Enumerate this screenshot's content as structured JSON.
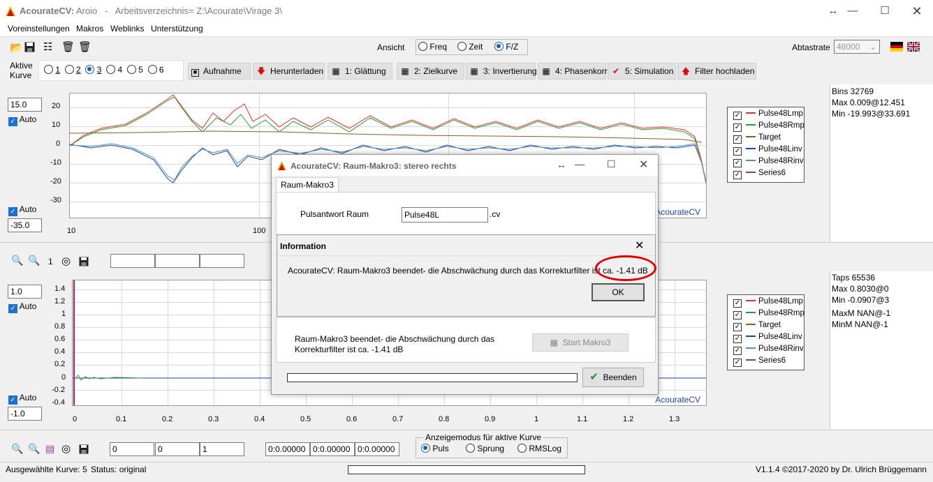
{
  "window": {
    "app_name": "AcourateCV:",
    "title_rest": "Aroio   -   Arbeitsverzeichnis= Z:\\Acourate\\Virage 3\\"
  },
  "menu": [
    "Voreinstellungen",
    "Makros",
    "Weblinks",
    "Unterstützung"
  ],
  "view": {
    "label": "Ansicht",
    "options": [
      "Freq",
      "Zeit",
      "F/Z"
    ],
    "selected": "F/Z"
  },
  "sample_rate": {
    "label": "Abtastrate",
    "value": "48000"
  },
  "active_curve": {
    "label_line1": "Aktive",
    "label_line2": "Kurve",
    "options": [
      "1",
      "2",
      "3",
      "4",
      "5",
      "6"
    ],
    "selected": "3"
  },
  "steps": [
    {
      "label": "Aufnahme",
      "icon": "record-icon"
    },
    {
      "label": "Herunterladen",
      "icon": "download-arrow-icon"
    },
    {
      "label": "1: Glättung",
      "icon": "calculator-icon"
    },
    {
      "label": "2: Zielkurve",
      "icon": "calculator-icon"
    },
    {
      "label": "3: Invertierung",
      "icon": "calculator-icon"
    },
    {
      "label": "4: Phasenkorr",
      "icon": "calculator-icon"
    },
    {
      "label": "5: Simulation",
      "icon": "checkmark-icon"
    },
    {
      "label": "Filter hochladen",
      "icon": "upload-arrow-icon"
    }
  ],
  "freq_plot": {
    "ymax_field": "15.0",
    "ymin_field": "-35.0",
    "auto_label": "Auto",
    "watermark": "AcourateCV",
    "yticks": [
      "20",
      "10",
      "0",
      "-10",
      "-20",
      "-30"
    ],
    "xticks": [
      "10",
      "100"
    ]
  },
  "freq_stats": {
    "bins": "Bins 32769",
    "max": "Max 0.009@12.451",
    "min": "Min -19.993@33.691"
  },
  "time_plot": {
    "ymax_field": "1.0",
    "ymin_field": "-1.0",
    "auto_label": "Auto",
    "watermark": "AcourateCV",
    "yticks": [
      "1.4",
      "1.2",
      "1",
      "0.8",
      "0.6",
      "0.4",
      "0.2",
      "0",
      "-0.2",
      "-0.4"
    ],
    "xticks": [
      "0",
      "0.1",
      "0.2",
      "0.3",
      "0.4",
      "0.5",
      "0.6",
      "0.7",
      "0.8",
      "0.9",
      "1",
      "1.1",
      "1.2",
      "1.3"
    ]
  },
  "time_stats": {
    "taps": "Taps 65536",
    "max": "Max 0.8030@0",
    "min": "Min -0.0907@3",
    "maxm": "MaxM NAN@-1",
    "minm": "MinM NAN@-1"
  },
  "legend": [
    {
      "name": "Pulse48Lmp",
      "color": "#e03030"
    },
    {
      "name": "Pulse48Rmp",
      "color": "#2e9a2e"
    },
    {
      "name": "Target",
      "color": "#8b5a2b"
    },
    {
      "name": "Pulse48Linv",
      "color": "#1c3fbf"
    },
    {
      "name": "Pulse48Rinv",
      "color": "#4a9a9a"
    },
    {
      "name": "Series6",
      "color": "#555555"
    }
  ],
  "mid_toolbar": {
    "zoom_level": "1"
  },
  "bottom_toolbar": {
    "fields": [
      "0",
      "0",
      "1"
    ],
    "time_fields": [
      "0:0.00000",
      "0:0.00000",
      "0:0.00000"
    ],
    "mode_title": "Anzeigemodus für aktive Kurve",
    "modes": [
      "Puls",
      "Sprung",
      "RMSLog"
    ],
    "mode_selected": "Puls"
  },
  "status": {
    "selected": "Ausgewählte Kurve: 5",
    "state": "Status: original",
    "version": "V1.1.4 ©2017-2020 by Dr. Ulrich Brüggemann"
  },
  "dialog": {
    "title": "AcourateCV: Raum-Makro3: stereo rechts",
    "tab": "Raum-Makro3",
    "field_label": "Pulsantwort Raum",
    "field_value": "Pulse48L",
    "field_suffix": ".cv",
    "message_line1": "Raum-Makro3 beendet- die Abschwächung durch das",
    "message_line2": "Korrekturfilter ist ca. -1.41 dB",
    "start_button": "Start Makro3",
    "end_button": "Beenden",
    "progress": 0
  },
  "info": {
    "title": "Information",
    "message": "AcourateCV: Raum-Makro3 beendet- die Abschwächung durch das Korrekturfilter ist ca. -1.41 dB",
    "ok": "OK",
    "highlight_color": "#e00000"
  }
}
